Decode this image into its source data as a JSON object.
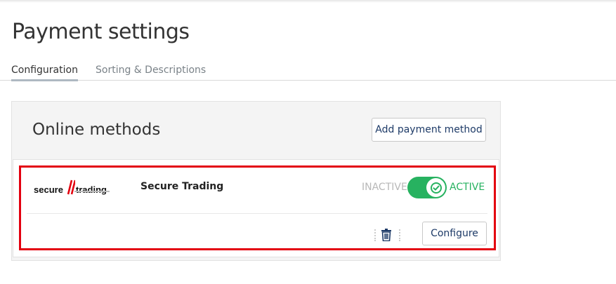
{
  "page": {
    "title": "Payment settings"
  },
  "tabs": [
    {
      "label": "Configuration",
      "active": true
    },
    {
      "label": "Sorting & Descriptions",
      "active": false
    }
  ],
  "online_methods": {
    "title": "Online methods",
    "add_button_label": "Add payment method",
    "methods": [
      {
        "logo_text_1": "secure",
        "logo_text_2": "trading",
        "name": "Secure Trading",
        "inactive_label": "INACTIVE",
        "active_label": "ACTIVE",
        "enabled": true,
        "configure_label": "Configure",
        "icons": {
          "toggle": "check-icon",
          "delete": "trash-icon",
          "drag": "drag-handle-icon"
        }
      }
    ]
  },
  "colors": {
    "accent_green": "#27b260",
    "button_text": "#1d3a67",
    "highlight_red": "#e3000f",
    "logo_red": "#e3000f"
  }
}
